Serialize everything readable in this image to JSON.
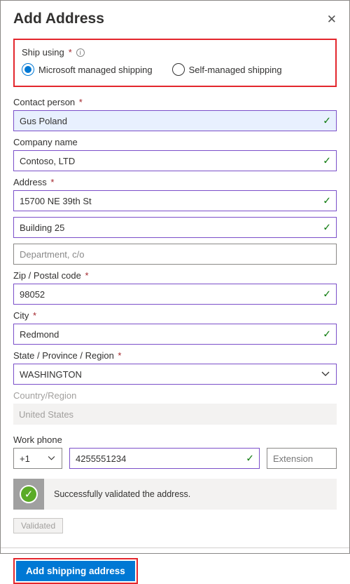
{
  "header": {
    "title": "Add Address"
  },
  "ship": {
    "label": "Ship using",
    "option_managed": "Microsoft managed shipping",
    "option_self": "Self-managed shipping"
  },
  "fields": {
    "contact_label": "Contact person",
    "contact_value": "Gus Poland",
    "company_label": "Company name",
    "company_value": "Contoso, LTD",
    "address_label": "Address",
    "address_line1": "15700 NE 39th St",
    "address_line2": "Building 25",
    "address_line3_placeholder": "Department, c/o",
    "zip_label": "Zip / Postal code",
    "zip_value": "98052",
    "city_label": "City",
    "city_value": "Redmond",
    "state_label": "State / Province / Region",
    "state_value": "WASHINGTON",
    "country_label": "Country/Region",
    "country_value": "United States",
    "phone_label": "Work phone",
    "phone_cc": "+1",
    "phone_number": "4255551234",
    "phone_ext_placeholder": "Extension"
  },
  "validation": {
    "success_msg": "Successfully validated the address.",
    "validated_btn": "Validated"
  },
  "footer": {
    "add_button": "Add shipping address"
  }
}
